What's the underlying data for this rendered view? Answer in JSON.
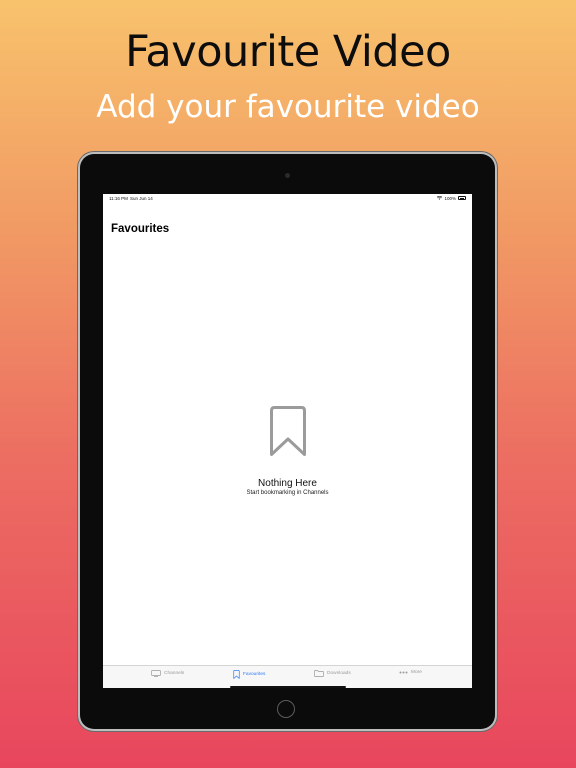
{
  "marketing": {
    "title": "Favourite Video",
    "subtitle": "Add your favourite video"
  },
  "status_bar": {
    "time": "11:16 PM",
    "date": "Sun Jun 14",
    "battery": "100%"
  },
  "nav": {
    "title": "Favourites"
  },
  "empty_state": {
    "icon": "bookmark-icon",
    "title": "Nothing Here",
    "subtitle": "Start bookmarking in Channels"
  },
  "tab_bar": {
    "active_color": "#2f7cf6",
    "inactive_color": "#9a9a9a",
    "tabs": [
      {
        "label": "Channels",
        "icon": "tv-icon",
        "active": false
      },
      {
        "label": "Favourites",
        "icon": "bookmark-icon",
        "active": true
      },
      {
        "label": "Downloads",
        "icon": "folder-icon",
        "active": false
      },
      {
        "label": "More",
        "icon": "more-icon",
        "active": false
      }
    ]
  }
}
